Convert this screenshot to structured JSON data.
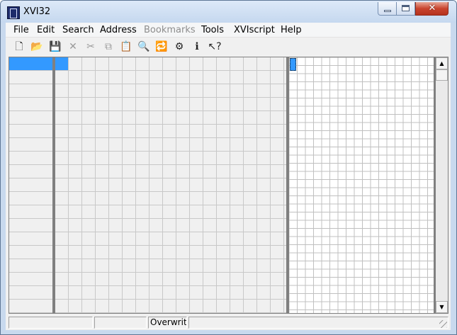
{
  "window": {
    "title": "XVI32"
  },
  "window_controls": {
    "minimize_icon": "minimize-icon",
    "maximize_icon": "maximize-icon",
    "close_glyph": "✕"
  },
  "menu": [
    {
      "label": "File",
      "enabled": true
    },
    {
      "label": "Edit",
      "enabled": true
    },
    {
      "label": "Search",
      "enabled": true
    },
    {
      "label": "Address",
      "enabled": true
    },
    {
      "label": "Bookmarks",
      "enabled": false
    },
    {
      "label": "Tools",
      "enabled": true
    },
    {
      "label": "XVIscript",
      "enabled": true
    },
    {
      "label": "Help",
      "enabled": true
    }
  ],
  "toolbar": [
    {
      "icon": "new-file-icon",
      "glyph": "🗋",
      "enabled": true
    },
    {
      "icon": "open-folder-icon",
      "glyph": "📂",
      "enabled": true
    },
    {
      "icon": "save-icon",
      "glyph": "💾",
      "enabled": false
    },
    {
      "icon": "delete-icon",
      "glyph": "✕",
      "enabled": false
    },
    {
      "icon": "cut-icon",
      "glyph": "✂",
      "enabled": false
    },
    {
      "icon": "copy-icon",
      "glyph": "⧉",
      "enabled": false
    },
    {
      "icon": "paste-icon",
      "glyph": "📋",
      "enabled": false
    },
    {
      "icon": "search-icon",
      "glyph": "🔍",
      "enabled": false
    },
    {
      "icon": "replace-icon",
      "glyph": "🔁",
      "enabled": false
    },
    {
      "icon": "settings-icon",
      "glyph": "⚙",
      "enabled": true
    },
    {
      "icon": "info-icon",
      "glyph": "ℹ",
      "enabled": true
    },
    {
      "icon": "context-help-icon",
      "glyph": "↖?",
      "enabled": true
    }
  ],
  "editor": {
    "address_selected_row": 0,
    "hex_selected_cell": 0,
    "text_cursor_cell": 0
  },
  "scrollbar": {
    "up_glyph": "▲",
    "down_glyph": "▼"
  },
  "status": {
    "panel1": "",
    "panel2": "",
    "mode": "Overwrit",
    "panel4": ""
  }
}
